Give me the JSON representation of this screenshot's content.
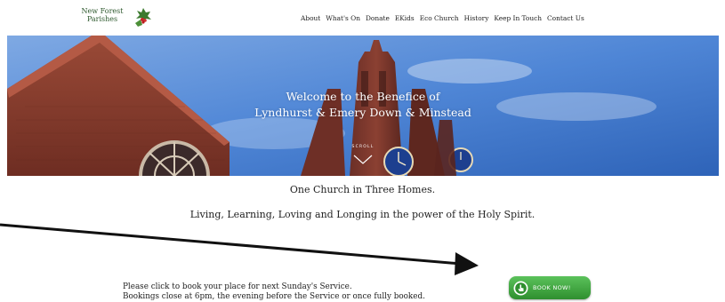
{
  "site": {
    "logo_line1": "New Forest",
    "logo_line2": "Parishes",
    "logo_icon": "holly-icon"
  },
  "nav": {
    "items": [
      {
        "label": "About"
      },
      {
        "label": "What's On"
      },
      {
        "label": "Donate"
      },
      {
        "label": "EKids"
      },
      {
        "label": "Eco Church"
      },
      {
        "label": "History"
      },
      {
        "label": "Keep In Touch"
      },
      {
        "label": "Contact Us"
      }
    ]
  },
  "hero": {
    "title_line1": "Welcome to the Benefice of",
    "title_line2": "Lyndhurst & Emery Down & Minstead",
    "scroll_label": "SCROLL",
    "scroll_icon": "chevron-down-icon"
  },
  "content": {
    "tagline1": "One Church in Three Homes.",
    "tagline2": "Living, Learning, Loving and Longing in the power of the Holy Spirit."
  },
  "booking": {
    "line1": "Please click to book your place for next Sunday's Service.",
    "line2": "Bookings close at 6pm, the evening before the Service or once fully booked.",
    "button_label": "BOOK NOW!",
    "button_icon": "hand-pointer-icon"
  },
  "colors": {
    "sky": "#4f86d6",
    "brick": "#8a3b2c",
    "button_green": "#3aa43a",
    "arrow": "#111111"
  }
}
